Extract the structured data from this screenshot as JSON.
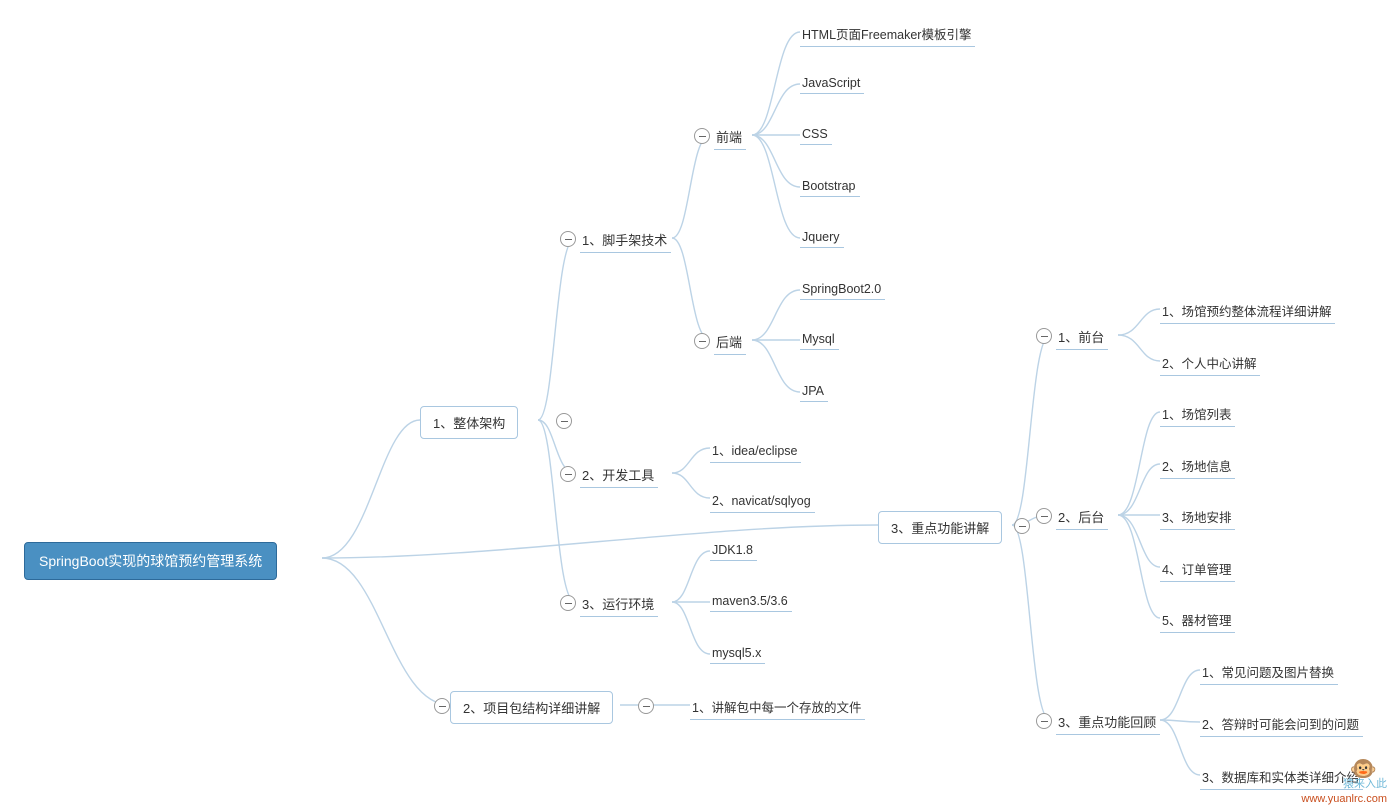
{
  "root": {
    "label": "SpringBoot实现的球馆预约管理系统"
  },
  "level1": {
    "arch": {
      "label": "1、整体架构"
    },
    "pkg": {
      "label": "2、项目包结构详细讲解"
    },
    "keyfn": {
      "label": "3、重点功能讲解"
    }
  },
  "arch_children": {
    "scaffold": {
      "label": "1、脚手架技术"
    },
    "devtool": {
      "label": "2、开发工具"
    },
    "runtime": {
      "label": "3、运行环境"
    }
  },
  "scaffold_children": {
    "frontend": {
      "label": "前端"
    },
    "backend": {
      "label": "后端"
    }
  },
  "frontend_leaves": {
    "html": "HTML页面Freemaker模板引擎",
    "js": "JavaScript",
    "css": "CSS",
    "bootstrap": "Bootstrap",
    "jquery": "Jquery"
  },
  "backend_leaves": {
    "sb": "SpringBoot2.0",
    "mysql": "Mysql",
    "jpa": "JPA"
  },
  "devtool_leaves": {
    "idea": "1、idea/eclipse",
    "navicat": "2、navicat/sqlyog"
  },
  "runtime_leaves": {
    "jdk": "JDK1.8",
    "maven": "maven3.5/3.6",
    "mysql": "mysql5.x"
  },
  "pkg_leaves": {
    "explain": "1、讲解包中每一个存放的文件"
  },
  "keyfn_children": {
    "front": {
      "label": "1、前台"
    },
    "back": {
      "label": "2、后台"
    },
    "review": {
      "label": "3、重点功能回顾"
    }
  },
  "front_leaves": {
    "flow": "1、场馆预约整体流程详细讲解",
    "profile": "2、个人中心讲解"
  },
  "back_leaves": {
    "list": "1、场馆列表",
    "venue": "2、场地信息",
    "sched": "3、场地安排",
    "order": "4、订单管理",
    "equip": "5、器材管理"
  },
  "review_leaves": {
    "faq": "1、常见问题及图片替换",
    "defense": "2、答辩时可能会问到的问题",
    "db": "3、数据库和实体类详细介绍"
  },
  "watermark": {
    "cn": "猿来入此",
    "url": "www.yuanlrc.com"
  }
}
